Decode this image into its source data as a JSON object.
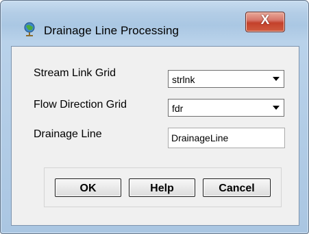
{
  "window": {
    "title": "Drainage Line Processing",
    "close_label": "X"
  },
  "form": {
    "stream_link_label": "Stream Link Grid",
    "stream_link_value": "strlnk",
    "flow_direction_label": "Flow Direction Grid",
    "flow_direction_value": "fdr",
    "drainage_line_label": "Drainage Line",
    "drainage_line_value": "DrainageLine"
  },
  "buttons": {
    "ok": "OK",
    "help": "Help",
    "cancel": "Cancel"
  },
  "icons": {
    "app": "globe-pin-icon",
    "close": "close-icon",
    "dropdown": "chevron-down-icon"
  }
}
